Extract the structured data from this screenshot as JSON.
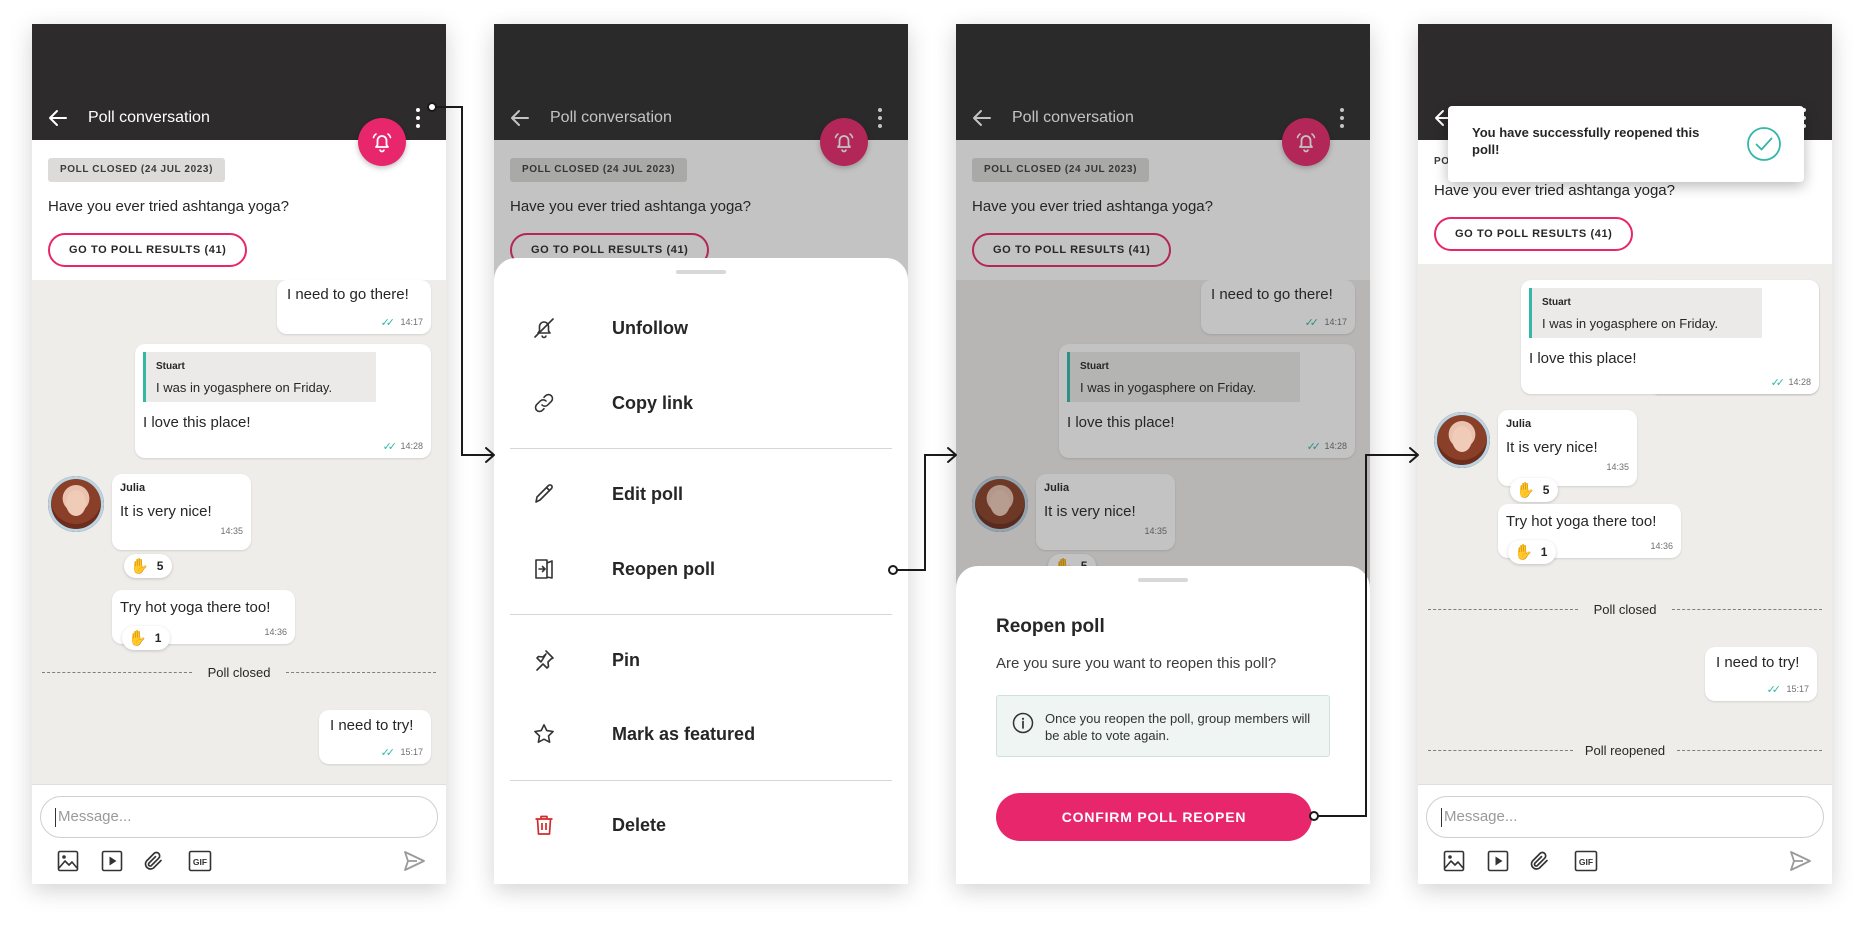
{
  "appbar_title": "Poll conversation",
  "poll": {
    "badge": "POLL CLOSED (24 JUL 2023)",
    "question": "Have you ever tried ashtanga yoga?",
    "results_button": "GO TO POLL RESULTS (41)"
  },
  "messages": {
    "m1": {
      "text": "I need to go there!",
      "time": "14:17"
    },
    "m2": {
      "quote_author": "Stuart",
      "quote_text": "I was in yogasphere on Friday.",
      "text": "I love this place!",
      "time": "14:28"
    },
    "m3": {
      "sender": "Julia",
      "text": "It is very nice!",
      "time": "14:35",
      "reaction_count": "5"
    },
    "m4": {
      "text": "Try hot yoga there too!",
      "time": "14:36",
      "reaction_count": "1"
    },
    "m5": {
      "text": "I need to try!",
      "time": "15:17"
    }
  },
  "dividers": {
    "closed": "Poll closed",
    "reopened": "Poll reopened"
  },
  "composer": {
    "placeholder": "Message..."
  },
  "menu": {
    "unfollow": "Unfollow",
    "copy_link": "Copy link",
    "edit_poll": "Edit poll",
    "reopen_poll": "Reopen poll",
    "pin": "Pin",
    "mark_featured": "Mark as featured",
    "delete": "Delete"
  },
  "dialog": {
    "title": "Reopen poll",
    "text": "Are you sure you want to reopen this poll?",
    "info": "Once you reopen the poll, group members will be able to vote again.",
    "confirm": "CONFIRM POLL REOPEN"
  },
  "toast": {
    "text": "You have successfully reopened this poll!"
  },
  "tick_glyph": "✓✓",
  "colors": {
    "accent": "#e8266b",
    "appbar": "#2d2b2b",
    "chat_bg": "#efedea",
    "read_ticks": "#34b7a7"
  },
  "icons": [
    "back-arrow-icon",
    "more-vertical-icon",
    "bell-icon",
    "image-icon",
    "video-icon",
    "attachment-icon",
    "gif-icon",
    "send-icon",
    "unfollow-icon",
    "link-icon",
    "pencil-icon",
    "reopen-icon",
    "pin-icon",
    "star-icon",
    "trash-icon",
    "info-icon",
    "check-circle-icon"
  ]
}
